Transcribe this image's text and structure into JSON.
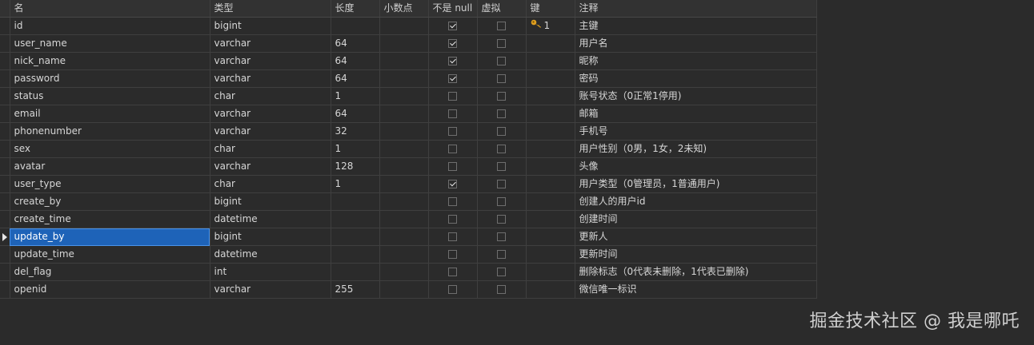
{
  "columns": {
    "name": "名",
    "type": "类型",
    "length": "长度",
    "decimals": "小数点",
    "not_null": "不是 null",
    "virtual": "虚拟",
    "key": "键",
    "comment": "注释"
  },
  "rows": [
    {
      "name": "id",
      "type": "bigint",
      "length": "",
      "decimals": "",
      "not_null": true,
      "virtual": false,
      "key": "1",
      "comment": "主键"
    },
    {
      "name": "user_name",
      "type": "varchar",
      "length": "64",
      "decimals": "",
      "not_null": true,
      "virtual": false,
      "key": "",
      "comment": "用户名"
    },
    {
      "name": "nick_name",
      "type": "varchar",
      "length": "64",
      "decimals": "",
      "not_null": true,
      "virtual": false,
      "key": "",
      "comment": "昵称"
    },
    {
      "name": "password",
      "type": "varchar",
      "length": "64",
      "decimals": "",
      "not_null": true,
      "virtual": false,
      "key": "",
      "comment": "密码"
    },
    {
      "name": "status",
      "type": "char",
      "length": "1",
      "decimals": "",
      "not_null": false,
      "virtual": false,
      "key": "",
      "comment": "账号状态（0正常1停用)"
    },
    {
      "name": "email",
      "type": "varchar",
      "length": "64",
      "decimals": "",
      "not_null": false,
      "virtual": false,
      "key": "",
      "comment": "邮箱"
    },
    {
      "name": "phonenumber",
      "type": "varchar",
      "length": "32",
      "decimals": "",
      "not_null": false,
      "virtual": false,
      "key": "",
      "comment": "手机号"
    },
    {
      "name": "sex",
      "type": "char",
      "length": "1",
      "decimals": "",
      "not_null": false,
      "virtual": false,
      "key": "",
      "comment": "用户性别（0男，1女，2未知)"
    },
    {
      "name": "avatar",
      "type": "varchar",
      "length": "128",
      "decimals": "",
      "not_null": false,
      "virtual": false,
      "key": "",
      "comment": "头像"
    },
    {
      "name": "user_type",
      "type": "char",
      "length": "1",
      "decimals": "",
      "not_null": true,
      "virtual": false,
      "key": "",
      "comment": "用户类型（0管理员，1普通用户)"
    },
    {
      "name": "create_by",
      "type": "bigint",
      "length": "",
      "decimals": "",
      "not_null": false,
      "virtual": false,
      "key": "",
      "comment": "创建人的用户id"
    },
    {
      "name": "create_time",
      "type": "datetime",
      "length": "",
      "decimals": "",
      "not_null": false,
      "virtual": false,
      "key": "",
      "comment": "创建时间"
    },
    {
      "name": "update_by",
      "type": "bigint",
      "length": "",
      "decimals": "",
      "not_null": false,
      "virtual": false,
      "key": "",
      "comment": "更新人",
      "selected": true
    },
    {
      "name": "update_time",
      "type": "datetime",
      "length": "",
      "decimals": "",
      "not_null": false,
      "virtual": false,
      "key": "",
      "comment": "更新时间"
    },
    {
      "name": "del_flag",
      "type": "int",
      "length": "",
      "decimals": "",
      "not_null": false,
      "virtual": false,
      "key": "",
      "comment": "删除标志（0代表未删除，1代表已删除)"
    },
    {
      "name": "openid",
      "type": "varchar",
      "length": "255",
      "decimals": "",
      "not_null": false,
      "virtual": false,
      "key": "",
      "comment": "微信唯一标识"
    }
  ],
  "watermark": "掘金技术社区 @ 我是哪吒",
  "colors": {
    "selection": "#1e63b8",
    "key": "#e0a020"
  },
  "icons": {
    "key": "key-icon",
    "row_indicator": "row-pointer-icon"
  }
}
